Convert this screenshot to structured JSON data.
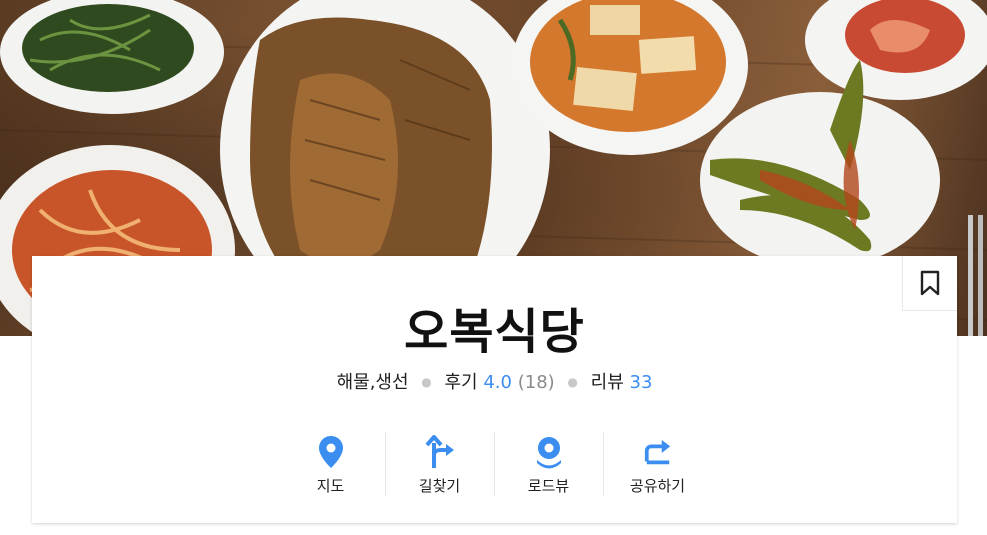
{
  "hero": {
    "alt": "오복식당 대표 사진"
  },
  "place": {
    "name": "오복식당",
    "category": "해물,생선",
    "review_label": "후기",
    "rating": "4.0",
    "review_count": "(18)",
    "blog_review_label": "리뷰",
    "blog_review_count": "33"
  },
  "actions": [
    {
      "label": "지도",
      "icon": "map-pin-icon"
    },
    {
      "label": "길찾기",
      "icon": "directions-icon"
    },
    {
      "label": "로드뷰",
      "icon": "roadview-icon"
    },
    {
      "label": "공유하기",
      "icon": "share-icon"
    }
  ],
  "colors": {
    "accent": "#3b8ef0",
    "text": "#111111",
    "muted": "#8a8a8a"
  }
}
